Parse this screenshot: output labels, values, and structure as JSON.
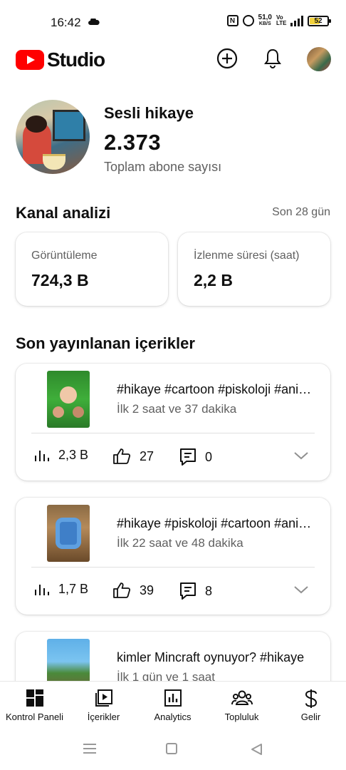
{
  "status_bar": {
    "time": "16:42",
    "net_speed": "51,0",
    "net_unit": "KB/S",
    "volte": "Vo LTE",
    "signal_label": "4G",
    "battery": "52"
  },
  "app": {
    "logo_text": "Studio",
    "brand_color": "#ff0000"
  },
  "channel": {
    "name": "Sesli hikaye",
    "subscribers": "2.373",
    "subscribers_label": "Toplam abone sayısı"
  },
  "analytics": {
    "title": "Kanal analizi",
    "period": "Son 28 gün",
    "metrics": [
      {
        "label": "Görüntüleme",
        "value": "724,3 B"
      },
      {
        "label": "İzlenme süresi (saat)",
        "value": "2,2 B"
      }
    ]
  },
  "recent": {
    "title": "Son yayınlanan içerikler",
    "items": [
      {
        "title": "#hikaye #cartoon #piskoloji #animation",
        "subtitle": "İlk 2 saat ve 37 dakika",
        "views": "2,3 B",
        "likes": "27",
        "comments": "0"
      },
      {
        "title": "#hikaye #piskoloji #cartoon #animation",
        "subtitle": "İlk 22 saat ve 48 dakika",
        "views": "1,7 B",
        "likes": "39",
        "comments": "8"
      },
      {
        "title": "kimler Mincraft oynuyor? #hikaye",
        "subtitle": "İlk 1 gün ve 1 saat"
      }
    ]
  },
  "bottom_nav": [
    {
      "label": "Kontrol Paneli",
      "icon": "dashboard-icon"
    },
    {
      "label": "İçerikler",
      "icon": "content-icon"
    },
    {
      "label": "Analytics",
      "icon": "analytics-icon"
    },
    {
      "label": "Topluluk",
      "icon": "community-icon"
    },
    {
      "label": "Gelir",
      "icon": "earn-icon"
    }
  ]
}
